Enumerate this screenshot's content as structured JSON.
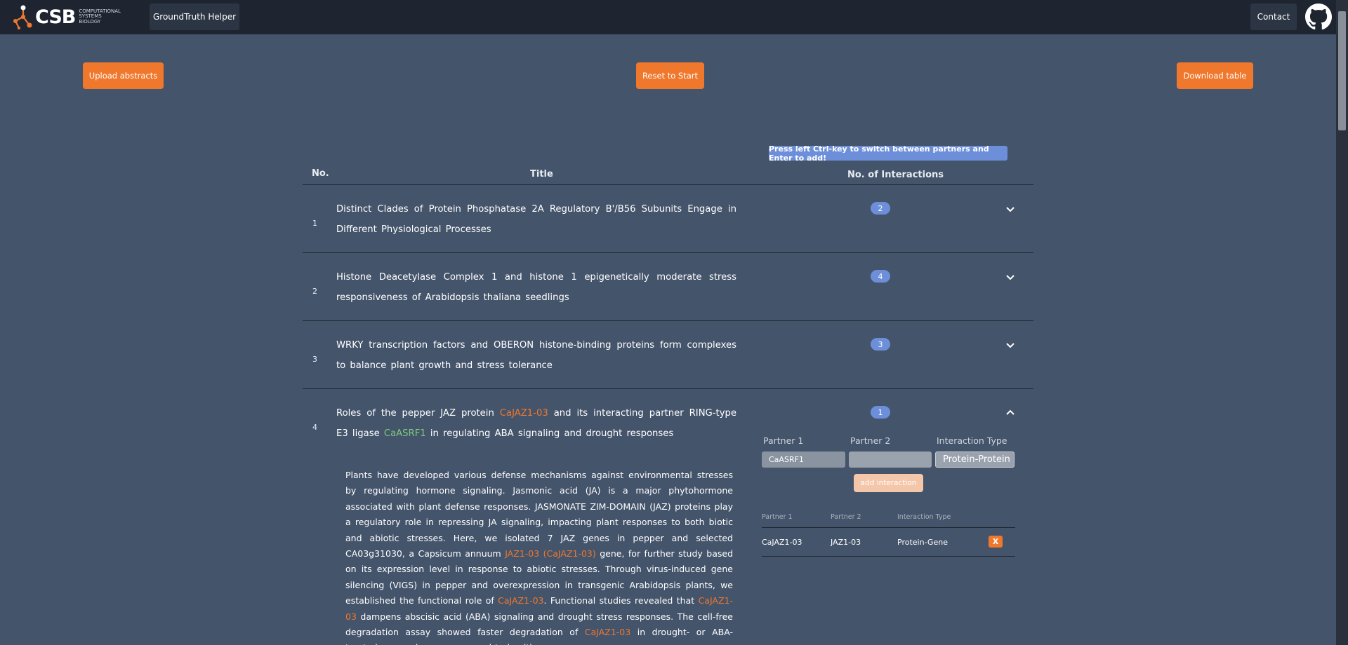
{
  "navbar": {
    "logo_text": "CSB",
    "logo_sub": [
      "COMPUTATIONAL",
      "SYSTEMS",
      "BIOLOGY"
    ],
    "app_button": "GroundTruth Helper",
    "contact": "Contact",
    "github_icon": "github-icon"
  },
  "actions": {
    "upload": "Upload abstracts",
    "reset": "Reset to Start",
    "download": "Download table"
  },
  "tooltip": "Press left Ctrl-key to switch between partners and Enter to add!",
  "table": {
    "headers": {
      "no": "No.",
      "title": "Title",
      "interactions": "No. of Interactions"
    },
    "rows": [
      {
        "no": "1",
        "title": "Distinct Clades of Protein Phosphatase 2A Regulatory B'/B56 Subunits Engage in Different Physiological Processes",
        "count": "2",
        "expanded": false
      },
      {
        "no": "2",
        "title": "Histone Deacetylase Complex 1 and histone 1 epigenetically moderate stress responsiveness of Arabidopsis thaliana seedlings",
        "count": "4",
        "expanded": false
      },
      {
        "no": "3",
        "title": "WRKY transcription factors and OBERON histone-binding proteins form complexes to balance plant growth and stress tolerance",
        "count": "3",
        "expanded": false
      },
      {
        "no": "4",
        "title_parts": [
          "Roles of the pepper JAZ protein ",
          "CaJAZ1-03",
          " and its interacting partner RING-type E3 ligase ",
          "CaASRF1",
          " in regulating ABA signaling and drought responses"
        ],
        "count": "1",
        "expanded": true
      }
    ]
  },
  "abstract_parts": [
    "Plants have developed various defense mechanisms against environmental stresses by regulating hormone signaling. Jasmonic acid (JA) is a major phytohormone associated with plant defense responses. JASMONATE ZIM-DOMAIN (JAZ) proteins play a regulatory role in repressing JA signaling, impacting plant responses to both biotic and abiotic stresses. Here, we isolated 7 JAZ genes in pepper and selected CA03g31030, a Capsicum annuum ",
    "JAZ1-03 (CaJAZ1-03)",
    " gene, for further study based on its expression level in response to abiotic stresses. Through virus-induced gene silencing (VIGS) in pepper and overexpression in transgenic Arabidopsis plants, we established the functional role of ",
    "CaJAZ1-03",
    ". Functional studies revealed that ",
    "CaJAZ1-03",
    " dampens abscisic acid (ABA) signaling and drought stress responses. The cell-free degradation assay showed faster degradation of ",
    "CaJAZ1-03",
    " in drought- or ABA-treated pepper leaves compared to healthy"
  ],
  "interaction_form": {
    "labels": {
      "p1": "Partner 1",
      "p2": "Partner 2",
      "type": "Interaction Type"
    },
    "p1_value": "CaASRF1",
    "p2_value": "",
    "type_value": "Protein-Protein",
    "add_button": "add interaction"
  },
  "interactions": {
    "headers": {
      "p1": "Partner 1",
      "p2": "Partner 2",
      "type": "Interaction Type"
    },
    "rows": [
      {
        "p1": "CaJAZ1-03",
        "p2": "JAZ1-03",
        "type": "Protein-Gene",
        "delete": "X"
      }
    ]
  },
  "colors": {
    "background": "#44546b",
    "navbar": "#1e2531",
    "accent": "#f0782d",
    "badge": "#6d8fd9",
    "highlight_partner2": "#7ec97a"
  }
}
